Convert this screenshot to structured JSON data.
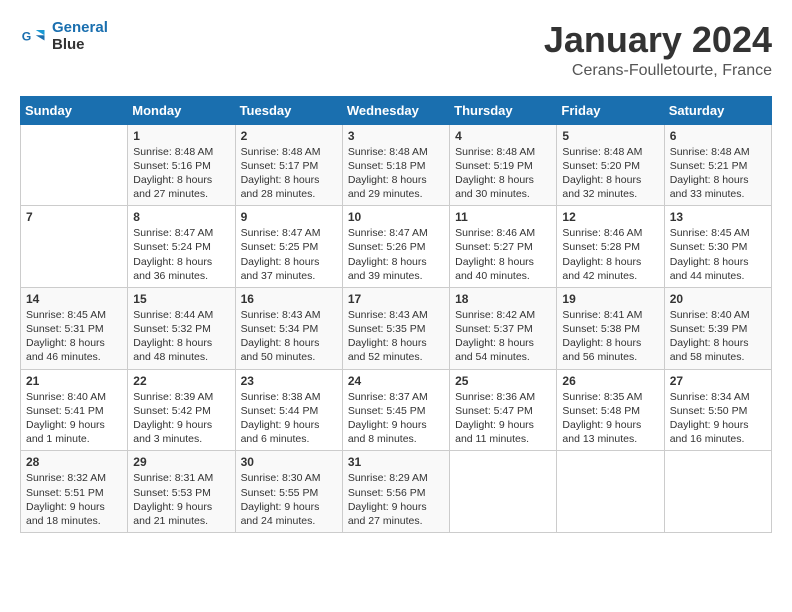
{
  "header": {
    "logo_line1": "General",
    "logo_line2": "Blue",
    "month": "January 2024",
    "location": "Cerans-Foulletourte, France"
  },
  "weekdays": [
    "Sunday",
    "Monday",
    "Tuesday",
    "Wednesday",
    "Thursday",
    "Friday",
    "Saturday"
  ],
  "weeks": [
    [
      {
        "day": "",
        "text": ""
      },
      {
        "day": "1",
        "text": "Sunrise: 8:48 AM\nSunset: 5:16 PM\nDaylight: 8 hours\nand 27 minutes."
      },
      {
        "day": "2",
        "text": "Sunrise: 8:48 AM\nSunset: 5:17 PM\nDaylight: 8 hours\nand 28 minutes."
      },
      {
        "day": "3",
        "text": "Sunrise: 8:48 AM\nSunset: 5:18 PM\nDaylight: 8 hours\nand 29 minutes."
      },
      {
        "day": "4",
        "text": "Sunrise: 8:48 AM\nSunset: 5:19 PM\nDaylight: 8 hours\nand 30 minutes."
      },
      {
        "day": "5",
        "text": "Sunrise: 8:48 AM\nSunset: 5:20 PM\nDaylight: 8 hours\nand 32 minutes."
      },
      {
        "day": "6",
        "text": "Sunrise: 8:48 AM\nSunset: 5:21 PM\nDaylight: 8 hours\nand 33 minutes."
      }
    ],
    [
      {
        "day": "7",
        "text": ""
      },
      {
        "day": "8",
        "text": "Sunrise: 8:47 AM\nSunset: 5:24 PM\nDaylight: 8 hours\nand 36 minutes."
      },
      {
        "day": "9",
        "text": "Sunrise: 8:47 AM\nSunset: 5:25 PM\nDaylight: 8 hours\nand 37 minutes."
      },
      {
        "day": "10",
        "text": "Sunrise: 8:47 AM\nSunset: 5:26 PM\nDaylight: 8 hours\nand 39 minutes."
      },
      {
        "day": "11",
        "text": "Sunrise: 8:46 AM\nSunset: 5:27 PM\nDaylight: 8 hours\nand 40 minutes."
      },
      {
        "day": "12",
        "text": "Sunrise: 8:46 AM\nSunset: 5:28 PM\nDaylight: 8 hours\nand 42 minutes."
      },
      {
        "day": "13",
        "text": "Sunrise: 8:45 AM\nSunset: 5:30 PM\nDaylight: 8 hours\nand 44 minutes."
      }
    ],
    [
      {
        "day": "14",
        "text": "Sunrise: 8:45 AM\nSunset: 5:31 PM\nDaylight: 8 hours\nand 46 minutes."
      },
      {
        "day": "15",
        "text": "Sunrise: 8:44 AM\nSunset: 5:32 PM\nDaylight: 8 hours\nand 48 minutes."
      },
      {
        "day": "16",
        "text": "Sunrise: 8:43 AM\nSunset: 5:34 PM\nDaylight: 8 hours\nand 50 minutes."
      },
      {
        "day": "17",
        "text": "Sunrise: 8:43 AM\nSunset: 5:35 PM\nDaylight: 8 hours\nand 52 minutes."
      },
      {
        "day": "18",
        "text": "Sunrise: 8:42 AM\nSunset: 5:37 PM\nDaylight: 8 hours\nand 54 minutes."
      },
      {
        "day": "19",
        "text": "Sunrise: 8:41 AM\nSunset: 5:38 PM\nDaylight: 8 hours\nand 56 minutes."
      },
      {
        "day": "20",
        "text": "Sunrise: 8:40 AM\nSunset: 5:39 PM\nDaylight: 8 hours\nand 58 minutes."
      }
    ],
    [
      {
        "day": "21",
        "text": "Sunrise: 8:40 AM\nSunset: 5:41 PM\nDaylight: 9 hours\nand 1 minute."
      },
      {
        "day": "22",
        "text": "Sunrise: 8:39 AM\nSunset: 5:42 PM\nDaylight: 9 hours\nand 3 minutes."
      },
      {
        "day": "23",
        "text": "Sunrise: 8:38 AM\nSunset: 5:44 PM\nDaylight: 9 hours\nand 6 minutes."
      },
      {
        "day": "24",
        "text": "Sunrise: 8:37 AM\nSunset: 5:45 PM\nDaylight: 9 hours\nand 8 minutes."
      },
      {
        "day": "25",
        "text": "Sunrise: 8:36 AM\nSunset: 5:47 PM\nDaylight: 9 hours\nand 11 minutes."
      },
      {
        "day": "26",
        "text": "Sunrise: 8:35 AM\nSunset: 5:48 PM\nDaylight: 9 hours\nand 13 minutes."
      },
      {
        "day": "27",
        "text": "Sunrise: 8:34 AM\nSunset: 5:50 PM\nDaylight: 9 hours\nand 16 minutes."
      }
    ],
    [
      {
        "day": "28",
        "text": "Sunrise: 8:32 AM\nSunset: 5:51 PM\nDaylight: 9 hours\nand 18 minutes."
      },
      {
        "day": "29",
        "text": "Sunrise: 8:31 AM\nSunset: 5:53 PM\nDaylight: 9 hours\nand 21 minutes."
      },
      {
        "day": "30",
        "text": "Sunrise: 8:30 AM\nSunset: 5:55 PM\nDaylight: 9 hours\nand 24 minutes."
      },
      {
        "day": "31",
        "text": "Sunrise: 8:29 AM\nSunset: 5:56 PM\nDaylight: 9 hours\nand 27 minutes."
      },
      {
        "day": "",
        "text": ""
      },
      {
        "day": "",
        "text": ""
      },
      {
        "day": "",
        "text": ""
      }
    ]
  ]
}
